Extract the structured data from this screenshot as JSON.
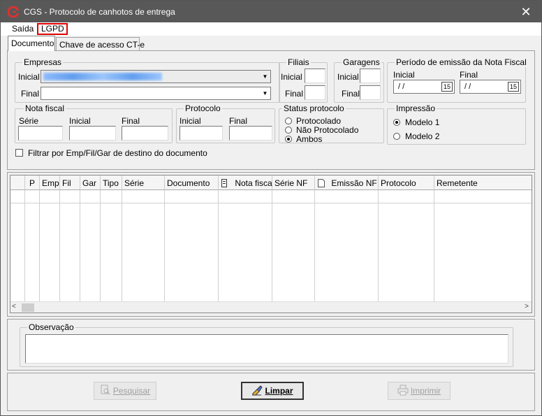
{
  "window": {
    "title": "CGS - Protocolo de canhotos de entrega",
    "close_label": "✕"
  },
  "menu": {
    "items": [
      "Saída",
      "LGPD"
    ]
  },
  "tabs": [
    "Documento",
    "Chave de acesso CT-e"
  ],
  "empresas": {
    "title": "Empresas",
    "inicial_label": "Inicial",
    "final_label": "Final"
  },
  "filiais": {
    "title": "Filiais",
    "inicial_label": "Inicial",
    "final_label": "Final"
  },
  "garagens": {
    "title": "Garagens",
    "inicial_label": "Inicial",
    "final_label": "Final"
  },
  "periodo": {
    "title": "Período de emissão da Nota Fiscal",
    "inicial_label": "Inicial",
    "final_label": "Final",
    "inicial_value": "/  /",
    "final_value": "/  /",
    "cal_icon": "15"
  },
  "nota_fiscal": {
    "title": "Nota fiscal",
    "serie_label": "Série",
    "inicial_label": "Inicial",
    "final_label": "Final"
  },
  "protocolo": {
    "title": "Protocolo",
    "inicial_label": "Inicial",
    "final_label": "Final"
  },
  "status_protocolo": {
    "title": "Status protocolo",
    "options": [
      "Protocolado",
      "Não Protocolado",
      "Ambos"
    ],
    "selected": "Ambos"
  },
  "impressao": {
    "title": "Impressão",
    "options": [
      "Modelo 1",
      "Modelo 2"
    ],
    "selected": "Modelo 1"
  },
  "filtro_label": "Filtrar por Emp/Fil/Gar de destino do documento",
  "grid": {
    "columns": [
      "",
      "P",
      "Emp",
      "Fil",
      "Gar",
      "Tipo",
      "Série",
      "Documento",
      "Nota fiscal",
      "Série NF",
      "Emissão NF",
      "Protocolo",
      "Remetente"
    ]
  },
  "observacao": {
    "title": "Observação"
  },
  "buttons": {
    "pesquisar": "Pesquisar",
    "limpar": "Limpar",
    "imprimir": "Imprimir"
  }
}
